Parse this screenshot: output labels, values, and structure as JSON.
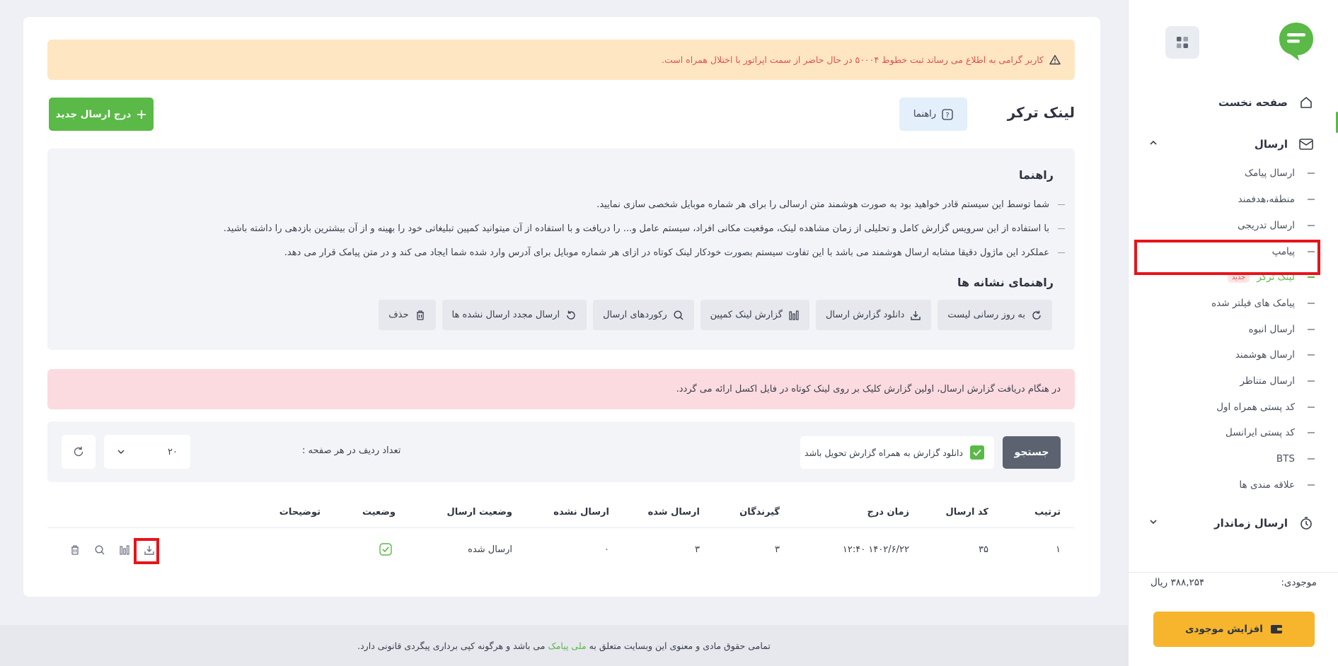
{
  "sidebar": {
    "menu": {
      "home": "صفحه نخست",
      "send": "ارسال",
      "scheduled": "ارسال زماندار",
      "send_items": [
        "ارسال پیامک",
        "منطقه،هدفمند",
        "ارسال تدریجی",
        "پیامپ",
        "لینک ترکر",
        "پیامک های فیلتر شده",
        "ارسال انبوه",
        "ارسال هوشمند",
        "ارسال متناظر",
        "کد پستی همراه اول",
        "کد پستی ایرانسل",
        "BTS",
        "علاقه مندی ها"
      ],
      "new_badge": "جدید"
    },
    "balance_label": "موجودی:",
    "balance_value": "۳۸۸,۲۵۴ ریال",
    "topup_label": "افزایش موجودی"
  },
  "alert": {
    "text": "کاربر گرامی به اطلاع می رساند ثبت خطوط ۵۰۰۰۴ در حال حاضر از سمت اپراتور با اختلال همراه است."
  },
  "page": {
    "title": "لینک ترکر",
    "guide_button": "راهنما",
    "new_button": "درج ارسال جدید"
  },
  "guide": {
    "title": "راهنما",
    "items": [
      "شما توسط این سیستم قادر خواهید بود به صورت هوشمند متن ارسالی را برای هر شماره موبایل شخصی سازی نمایید.",
      "با استفاده از این سرویس گزارش کامل و تحلیلی از زمان مشاهده لینک، موقعیت مکانی افراد، سیستم عامل و... را دریافت و با استفاده از آن میتوانید کمپین تبلیغاتی خود را بهینه و از آن بیشترین بازدهی را داشته باشید.",
      "عملکرد این ماژول دقیقا مشابه ارسال هوشمند می باشد با این تفاوت سیستم بصورت خودکار لینک کوتاه در ازای هر شماره موبایل برای آدرس وارد شده شما ایجاد می کند و در متن پیامک قرار می دهد."
    ],
    "icons_title": "راهنمای نشانه ها",
    "chips": [
      "به روز رسانی لیست",
      "دانلود گزارش ارسال",
      "گزارش لینک کمپین",
      "رکوردهای ارسال",
      "ارسال مجدد ارسال نشده ها",
      "حذف"
    ]
  },
  "notice": {
    "text": "در هنگام دریافت گزارش ارسال، اولین گزارش کلیک بر روی لینک کوتاه در فایل اکسل ارائه می گردد."
  },
  "filter": {
    "search_button": "جستجو",
    "checkbox_label": "دانلود گزارش به همراه گزارش تحویل باشد",
    "rows_label": "تعداد ردیف در هر صفحه :",
    "rows_value": "۲۰"
  },
  "table": {
    "headers": [
      "ترتیب",
      "کد ارسال",
      "زمان درج",
      "گیرندگان",
      "ارسال شده",
      "ارسال نشده",
      "وضعیت ارسال",
      "وضعیت",
      "توضیحات"
    ],
    "rows": [
      {
        "index": "۱",
        "code": "۳۵",
        "time": "۱۴۰۲/۶/۲۲ ۱۲:۴۰",
        "recipients": "۳",
        "sent": "۳",
        "not_sent": "۰",
        "send_status": "ارسال شده",
        "status": "active",
        "description": ""
      }
    ]
  },
  "footer": {
    "text_before": "تمامی حقوق مادی و معنوی این وبسایت متعلق به",
    "brand": "ملی پیامک",
    "text_after": "می باشد و هرگونه کپی برداری پیگردی قانونی دارد."
  },
  "colors": {
    "brand_green": "#5ab947",
    "accent_yellow": "#f6b52c",
    "alert_bg": "#ffe6c2",
    "notice_bg": "#fcdbe0",
    "highlight_red": "#e8141a"
  }
}
